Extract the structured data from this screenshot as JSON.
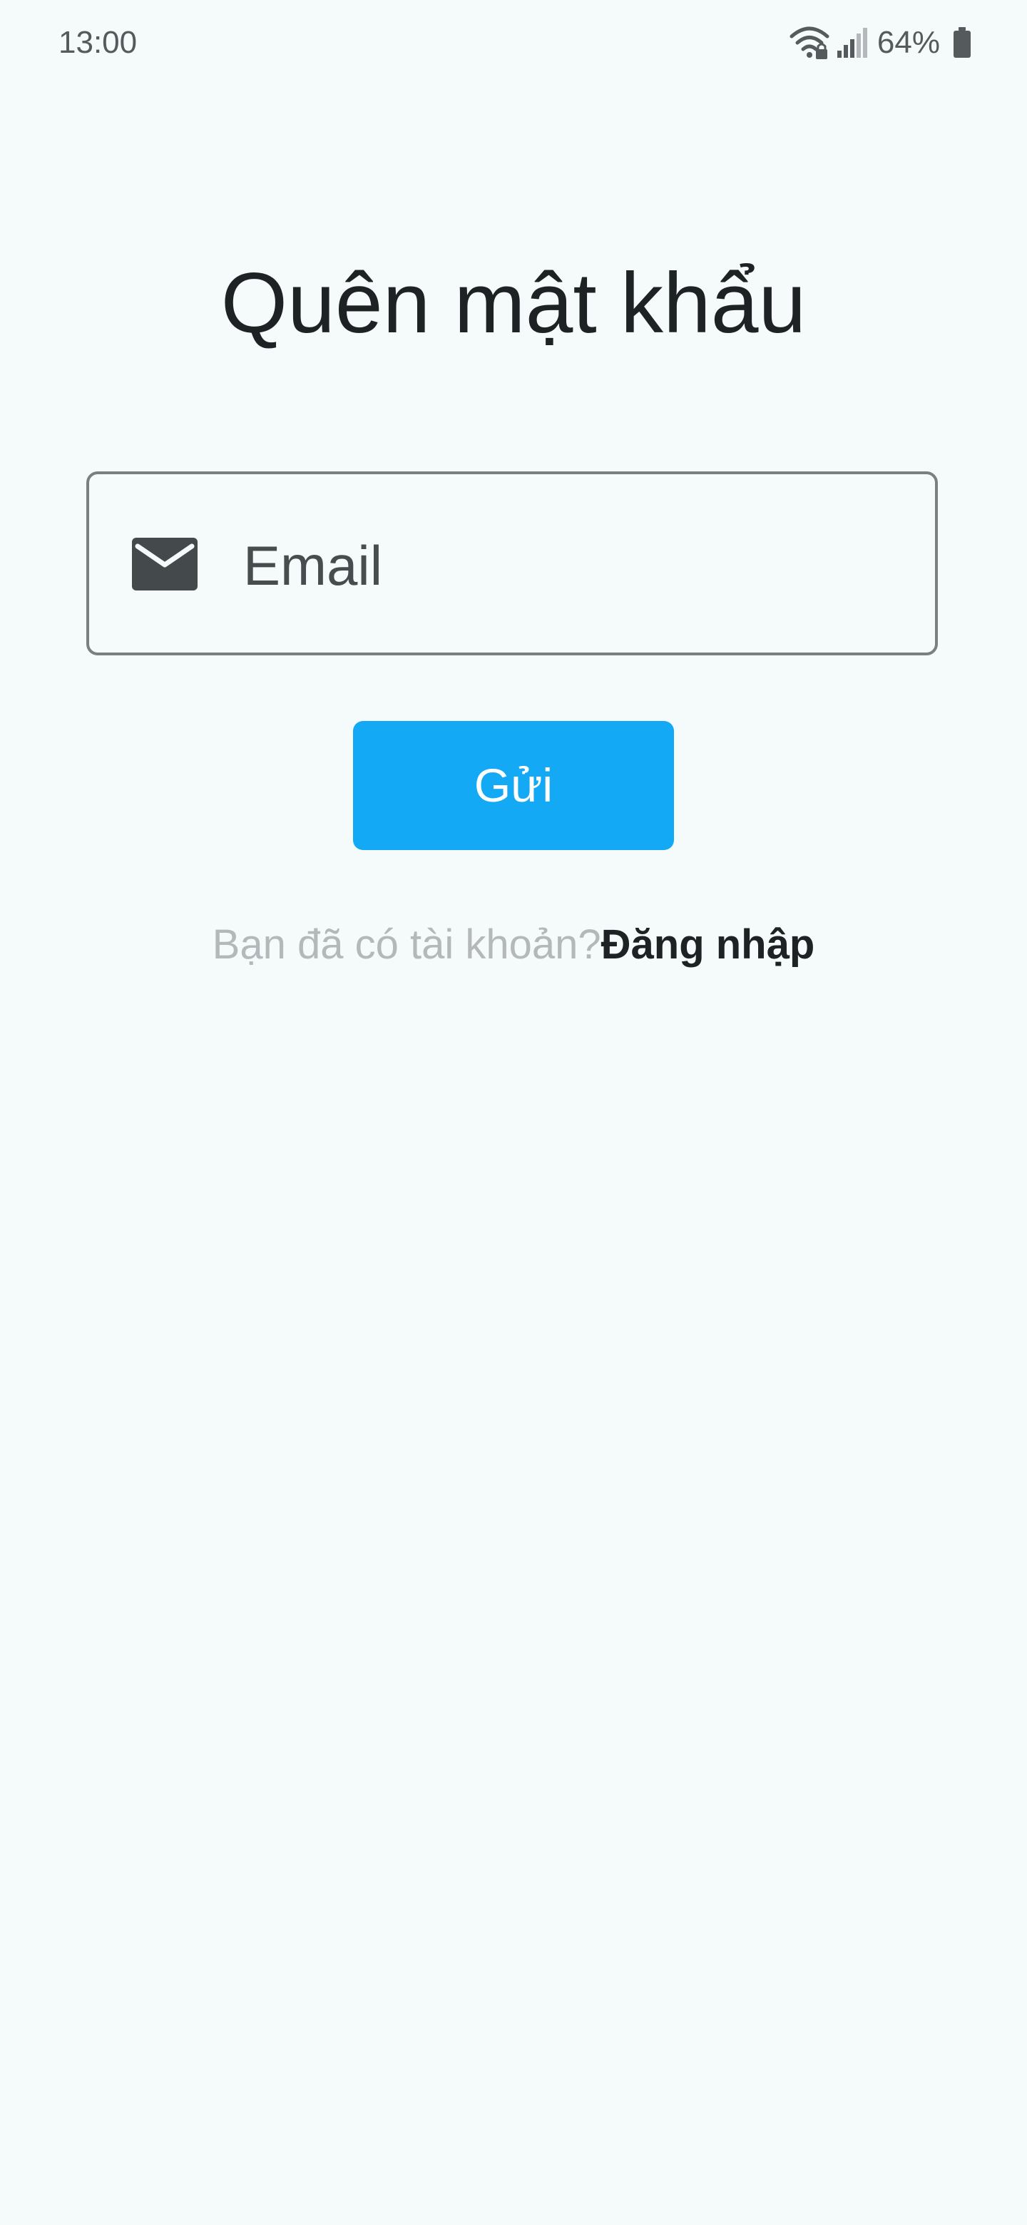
{
  "status_bar": {
    "time": "13:00",
    "battery_percent": "64%",
    "icons": [
      "wifi-icon",
      "signal-icon",
      "battery-icon"
    ]
  },
  "screen": {
    "title": "Quên mật khẩu"
  },
  "form": {
    "email": {
      "placeholder": "Email",
      "value": "",
      "icon": "mail-icon"
    },
    "submit_label": "Gửi"
  },
  "footer": {
    "prompt": "Bạn đã có tài khoản?",
    "login_link": "Đăng nhập"
  },
  "colors": {
    "background": "#f5fafb",
    "accent": "#14a9f4",
    "text_primary": "#1e2224",
    "text_muted": "#b4b8ba"
  }
}
